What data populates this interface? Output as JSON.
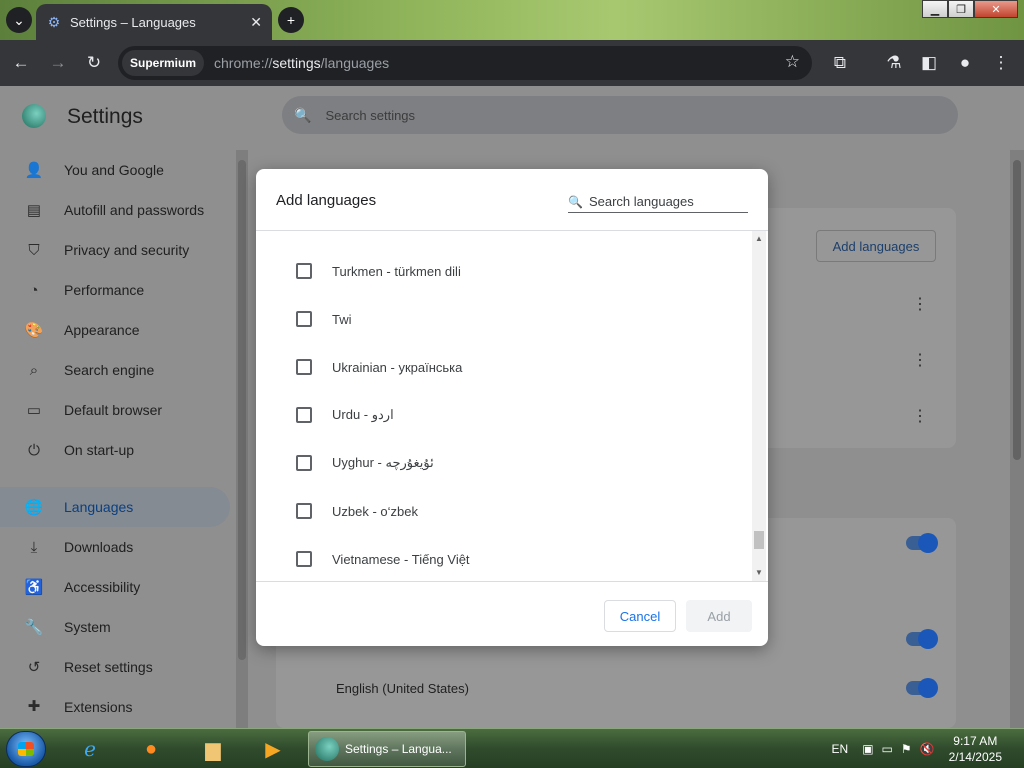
{
  "browser": {
    "tab_title": "Settings – Languages",
    "chip_label": "Supermium",
    "url_prefix": "chrome://",
    "url_host": "settings",
    "url_path": "/languages"
  },
  "settings": {
    "title": "Settings",
    "search_placeholder": "Search settings",
    "nav": [
      {
        "label": "You and Google",
        "icon": "person-icon"
      },
      {
        "label": "Autofill and passwords",
        "icon": "clipboard-icon"
      },
      {
        "label": "Privacy and security",
        "icon": "shield-icon"
      },
      {
        "label": "Performance",
        "icon": "gauge-icon"
      },
      {
        "label": "Appearance",
        "icon": "palette-icon"
      },
      {
        "label": "Search engine",
        "icon": "search-icon"
      },
      {
        "label": "Default browser",
        "icon": "browser-icon"
      },
      {
        "label": "On start-up",
        "icon": "power-icon"
      },
      {
        "label": "Languages",
        "icon": "globe-icon"
      },
      {
        "label": "Downloads",
        "icon": "download-icon"
      },
      {
        "label": "Accessibility",
        "icon": "accessibility-icon"
      },
      {
        "label": "System",
        "icon": "wrench-icon"
      },
      {
        "label": "Reset settings",
        "icon": "reset-icon"
      },
      {
        "label": "Extensions",
        "icon": "puzzle-icon"
      }
    ],
    "add_languages_button": "Add languages",
    "background_language": "English (United States)"
  },
  "dialog": {
    "title": "Add languages",
    "search_placeholder": "Search languages",
    "languages": [
      "Turkmen - türkmen dili",
      "Twi",
      "Ukrainian - українська",
      "Urdu - اردو",
      "Uyghur - ئۇيغۇرچە",
      "Uzbek - o‘zbek",
      "Vietnamese - Tiếng Việt"
    ],
    "cancel_label": "Cancel",
    "add_label": "Add"
  },
  "taskbar": {
    "task_label": "Settings – Langua...",
    "lang": "EN",
    "time": "9:17 AM",
    "date": "2/14/2025"
  }
}
